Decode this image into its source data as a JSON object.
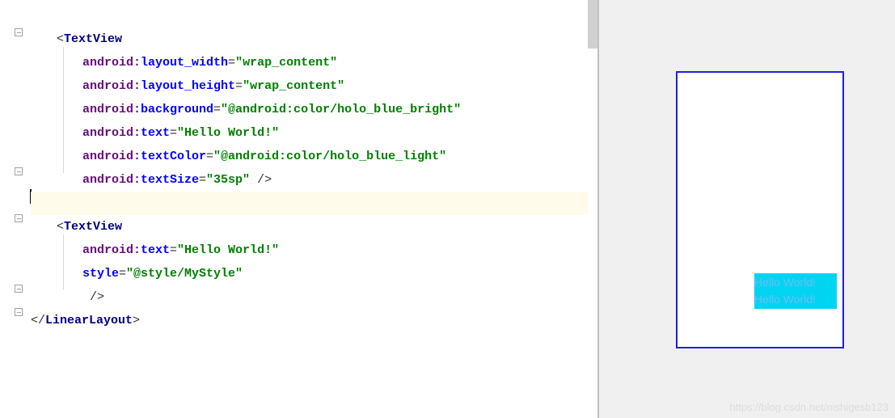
{
  "code": {
    "tag1_open": "<",
    "tag1_name": "TextView",
    "attr1_ns": "android:",
    "attr1_name": "layout_width",
    "attr1_eq": "=",
    "attr1_val": "\"wrap_content\"",
    "attr2_name": "layout_height",
    "attr2_val": "\"wrap_content\"",
    "attr3_name": "background",
    "attr3_val": "\"@android:color/holo_blue_bright\"",
    "attr4_name": "text",
    "attr4_val": "\"Hello World!\"",
    "attr5_name": "textColor",
    "attr5_val": "\"@android:color/holo_blue_light\"",
    "attr6_name": "textSize",
    "attr6_val": "\"35sp\"",
    "tag1_close": " />",
    "tag2_open": "<",
    "tag2_name": "TextView",
    "attr7_name": "text",
    "attr7_val": "\"Hello World!\"",
    "attr8_name": "style",
    "attr8_eq": "=",
    "attr8_val": "\"@style/MyStyle\"",
    "tag2_close": " />",
    "end_tag_open": "</",
    "end_tag_name": "LinearLayout",
    "end_tag_close": ">"
  },
  "preview": {
    "text1": "Hello World!",
    "text2": "Hello World!"
  },
  "watermark": "https://blog.csdn.net/nishigesb123"
}
